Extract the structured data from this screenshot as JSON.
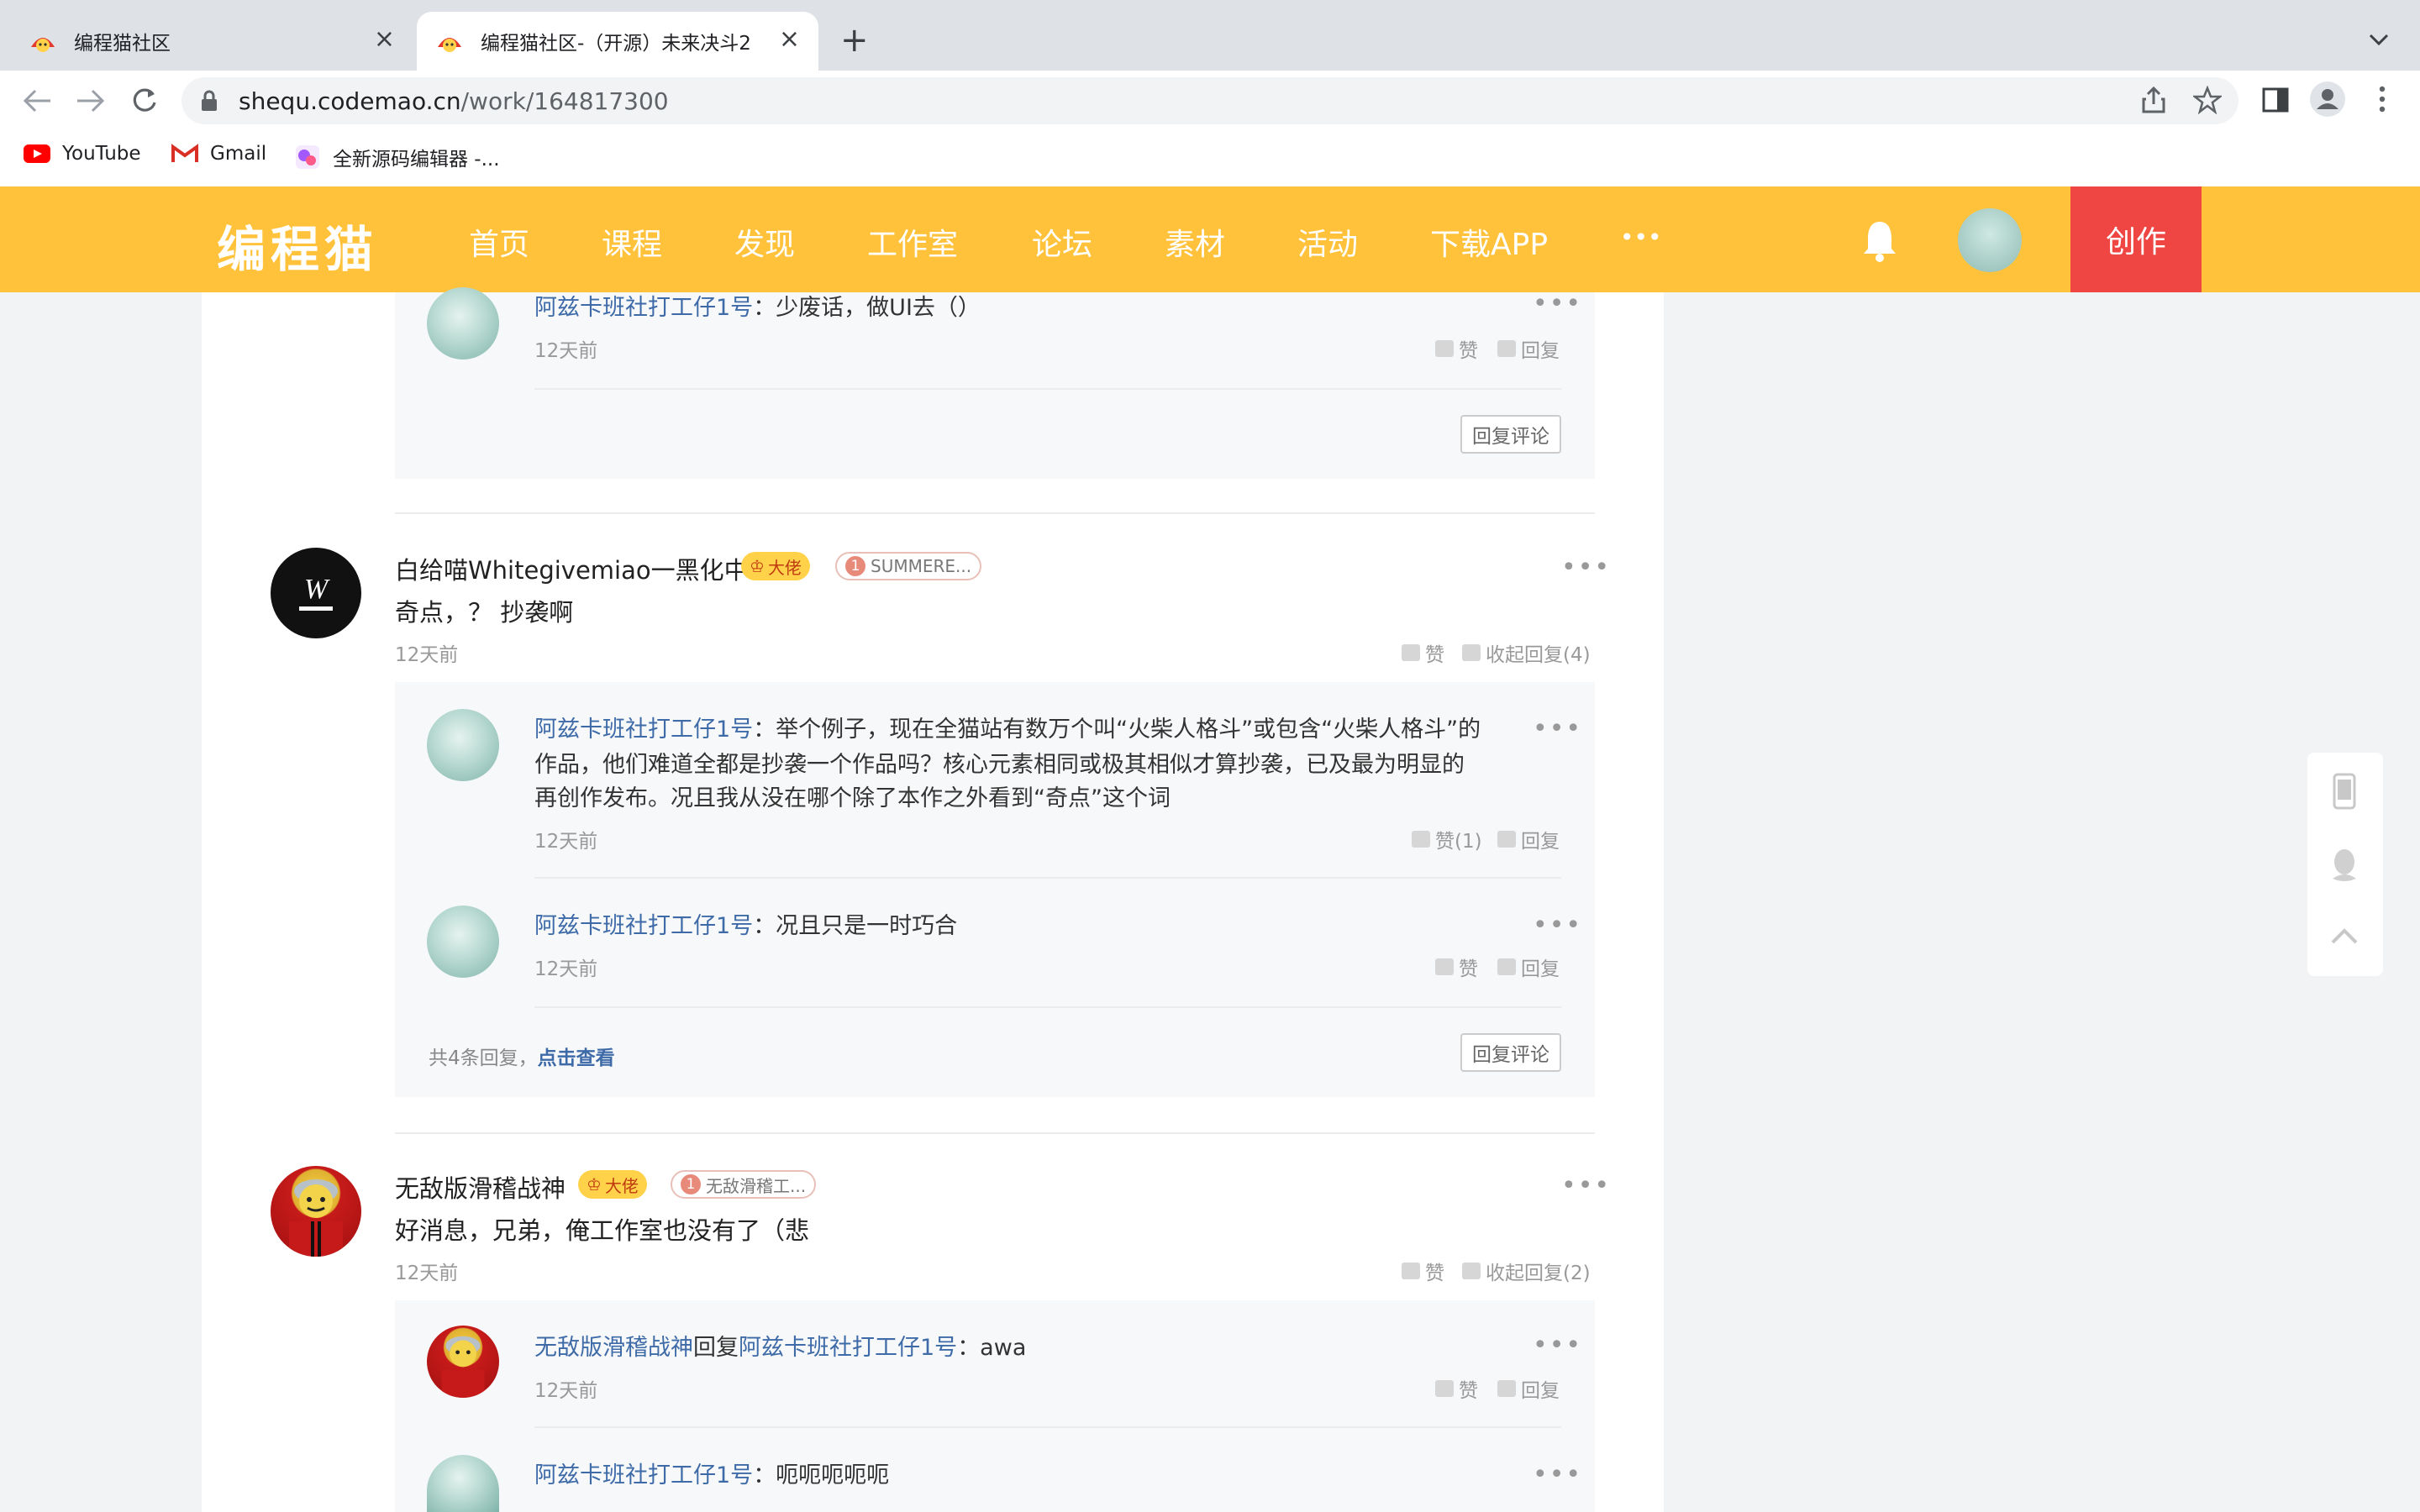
{
  "browser": {
    "tabs": [
      {
        "title": "编程猫社区",
        "active": false
      },
      {
        "title": "编程猫社区-（开源）未来决斗2",
        "active": true
      }
    ],
    "address": {
      "domain": "shequ.codemao.cn",
      "path": "/work/164817300"
    },
    "bookmarks": [
      {
        "label": "YouTube",
        "icon": "youtube-icon"
      },
      {
        "label": "Gmail",
        "icon": "gmail-icon"
      },
      {
        "label": "全新源码编辑器 -...",
        "icon": "editor-icon"
      }
    ]
  },
  "site": {
    "logo": "编程猫",
    "nav": [
      "首页",
      "课程",
      "发现",
      "工作室",
      "论坛",
      "素材",
      "活动",
      "下载APP",
      "•••"
    ],
    "create": "创作",
    "brand_color": "#ffc23a",
    "create_color": "#f04643"
  },
  "comments": {
    "top_reply": {
      "name": "阿兹卡班社打工仔1号",
      "text": "：少废话，做UI去（）",
      "time": "12天前",
      "like": "赞",
      "reply": "回复",
      "reply_comment": "回复评论"
    },
    "c1": {
      "name": "白给喵Whitegivemiao一黑化中",
      "badge1": "大佬",
      "badge2": "SUMMERE...",
      "badge2_num": "1",
      "text": "奇点，？ 抄袭啊",
      "time": "12天前",
      "like": "赞",
      "collapse": "收起回复(4)",
      "replies": [
        {
          "name": "阿兹卡班社打工仔1号",
          "line1": "：举个例子，现在全猫站有数万个叫“火柴人格斗”或包含“火柴人格斗”的",
          "line2": "作品，他们难道全都是抄袭一个作品吗？核心元素相同或极其相似才算抄袭，已及最为明显的",
          "line3": "再创作发布。况且我从没在哪个除了本作之外看到“奇点”这个词",
          "time": "12天前",
          "like": "赞(1)",
          "reply": "回复"
        },
        {
          "name": "阿兹卡班社打工仔1号",
          "text": "：况且只是一时巧合",
          "time": "12天前",
          "like": "赞",
          "reply": "回复"
        }
      ],
      "total": "共4条回复，",
      "view": "点击查看",
      "reply_comment": "回复评论"
    },
    "c2": {
      "name": "无敌版滑稽战神",
      "badge1": "大佬",
      "badge2": "无敌滑稽工...",
      "badge2_num": "1",
      "text": "好消息，兄弟，俺工作室也没有了（悲",
      "time": "12天前",
      "like": "赞",
      "collapse": "收起回复(2)",
      "replies": [
        {
          "name": "无敌版滑稽战神",
          "mid": "回复",
          "target": "阿兹卡班社打工仔1号",
          "text": "：awa",
          "time": "12天前",
          "like": "赞",
          "reply": "回复"
        },
        {
          "name": "阿兹卡班社打工仔1号",
          "text": "：呃呃呃呃呃"
        }
      ]
    }
  }
}
